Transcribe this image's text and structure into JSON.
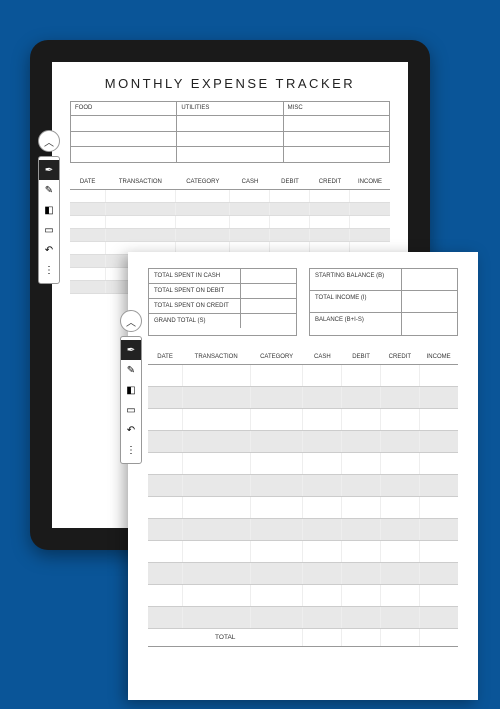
{
  "page1": {
    "title": "MONTHLY EXPENSE TRACKER",
    "categories": [
      "FOOD",
      "UTILITIES",
      "MISC"
    ],
    "tx_headers": [
      "DATE",
      "TRANSACTION",
      "CATEGORY",
      "CASH",
      "DEBIT",
      "CREDIT",
      "INCOME"
    ]
  },
  "toolbar": {
    "collapse": "︿",
    "icons": {
      "pen": "✒",
      "brush": "✎",
      "eraser": "◧",
      "select": "▭",
      "undo": "↶",
      "more": "⋮"
    }
  },
  "page2": {
    "summary_left": [
      "TOTAL SPENT IN CASH",
      "TOTAL SPENT ON DEBIT",
      "TOTAL SPENT ON CREDIT",
      "GRAND TOTAL (S)"
    ],
    "summary_right": [
      "STARTING BALANCE (B)",
      "TOTAL INCOME (I)",
      "BALANCE (B+I-S)"
    ],
    "tx_headers": [
      "DATE",
      "TRANSACTION",
      "CATEGORY",
      "CASH",
      "DEBIT",
      "CREDIT",
      "INCOME"
    ],
    "total_label": "TOTAL"
  }
}
